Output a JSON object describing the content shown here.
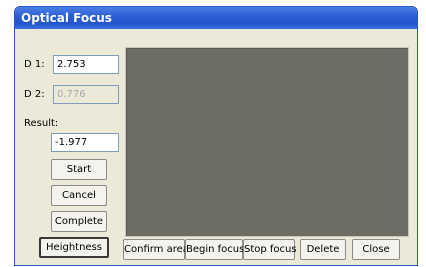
{
  "window": {
    "title": "Optical Focus"
  },
  "fields": {
    "d1": {
      "label": "D 1:",
      "value": "2.753"
    },
    "d2": {
      "label": "D 2:",
      "value": "0.776"
    },
    "result": {
      "label": "Result:",
      "value": "-1.977"
    }
  },
  "left_buttons": {
    "start": "Start",
    "cancel": "Cancel",
    "complete": "Complete",
    "heightness": "Heightness"
  },
  "bottom_buttons": {
    "confirm_area": "Confirm area",
    "begin_focus": "Begin focus",
    "stop_focus": "Stop focus",
    "delete": "Delete",
    "close": "Close"
  },
  "colors": {
    "title_bar": "#2a5cd4",
    "canvas": "#6d6d63",
    "dialog_bg": "#ece9d8"
  }
}
